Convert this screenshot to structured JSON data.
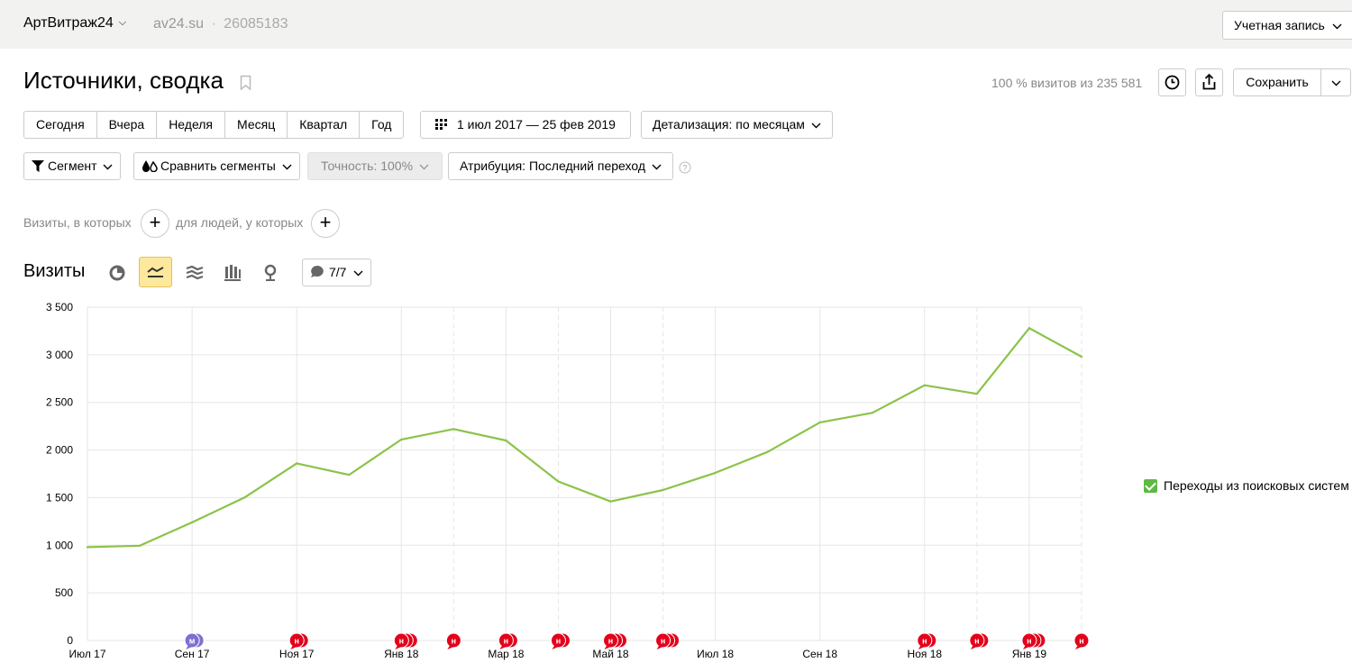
{
  "header": {
    "site_name": "АртВитраж24",
    "domain": "av24.su",
    "counter_id": "26085183",
    "account_button": "Учетная запись"
  },
  "report": {
    "title": "Источники, сводка",
    "visits_share": "100 % визитов из 235 581",
    "save_button": "Сохранить"
  },
  "period_buttons": [
    "Сегодня",
    "Вчера",
    "Неделя",
    "Месяц",
    "Квартал",
    "Год"
  ],
  "date_range": "1 июл 2017 — 25 фев 2019",
  "detail": "Детализация: по месяцам",
  "filters": {
    "segment": "Сегмент",
    "compare": "Сравнить сегменты",
    "accuracy": "Точность: 100%",
    "attribution": "Атрибуция: Последний переход"
  },
  "condition": {
    "visits_label": "Визиты, в которых",
    "people_label": "для людей, у которых"
  },
  "chart_section": {
    "title": "Визиты",
    "notes_button": "7/7"
  },
  "chart_data": {
    "type": "line",
    "x": [
      "Июл 17",
      "Авг 17",
      "Сен 17",
      "Окт 17",
      "Ноя 17",
      "Дек 17",
      "Янв 18",
      "Фев 18",
      "Мар 18",
      "Апр 18",
      "Май 18",
      "Июн 18",
      "Июл 18",
      "Авг 18",
      "Сен 18",
      "Окт 18",
      "Ноя 18",
      "Дек 18",
      "Янв 19",
      "Фев 19"
    ],
    "x_tick_labels": [
      "Июл 17",
      "Сен 17",
      "Ноя 17",
      "Янв 18",
      "Мар 18",
      "Май 18",
      "Июл 18",
      "Сен 18",
      "Ноя 18",
      "Янв 19"
    ],
    "y_tick_labels": [
      "0",
      "500",
      "1 000",
      "1 500",
      "2 000",
      "2 500",
      "3 000",
      "3 500"
    ],
    "ylim": [
      0,
      3500
    ],
    "series": [
      {
        "name": "Переходы из поисковых систем",
        "color": "#8bc34a",
        "values": [
          980,
          995,
          1240,
          1500,
          1860,
          1740,
          2110,
          2220,
          2100,
          1670,
          1460,
          1580,
          1760,
          1980,
          2290,
          2390,
          2680,
          2590,
          3280,
          2980
        ]
      }
    ],
    "grid": true,
    "legend_position": "right",
    "annotation_markers": [
      {
        "month_index": 2,
        "label": "м",
        "color": "#7e6fd0",
        "stack": 2
      },
      {
        "month_index": 4,
        "label": "н",
        "color": "#e3001b",
        "stack": 2
      },
      {
        "month_index": 6,
        "label": "н",
        "color": "#e3001b",
        "stack": 3
      },
      {
        "month_index": 7,
        "label": "н",
        "color": "#e3001b",
        "stack": 1
      },
      {
        "month_index": 8,
        "label": "н",
        "color": "#e3001b",
        "stack": 2
      },
      {
        "month_index": 9,
        "label": "н",
        "color": "#e3001b",
        "stack": 2
      },
      {
        "month_index": 10,
        "label": "н",
        "color": "#e3001b",
        "stack": 3
      },
      {
        "month_index": 11,
        "label": "н",
        "color": "#e3001b",
        "stack": 3
      },
      {
        "month_index": 16,
        "label": "н",
        "color": "#e3001b",
        "stack": 2
      },
      {
        "month_index": 17,
        "label": "н",
        "color": "#e3001b",
        "stack": 2
      },
      {
        "month_index": 18,
        "label": "н",
        "color": "#e3001b",
        "stack": 3
      },
      {
        "month_index": 19,
        "label": "н",
        "color": "#e3001b",
        "stack": 1
      }
    ]
  }
}
